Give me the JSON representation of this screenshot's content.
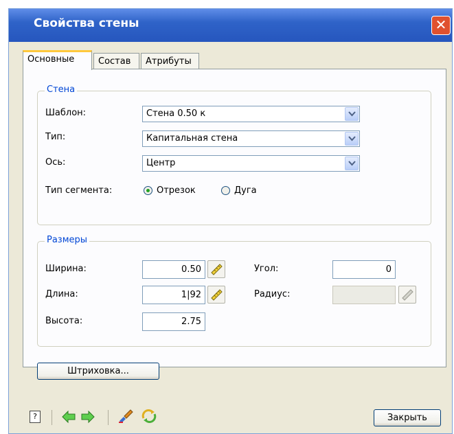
{
  "window": {
    "title": "Свойства стены",
    "close": "✕"
  },
  "tabs": [
    {
      "label": "Основные"
    },
    {
      "label": "Состав"
    },
    {
      "label": "Атрибуты"
    }
  ],
  "wall_group": {
    "legend": "Стена",
    "template_label": "Шаблон:",
    "template_value": "Стена 0.50 к",
    "type_label": "Тип:",
    "type_value": "Капитальная стена",
    "axis_label": "Ось:",
    "axis_value": "Центр",
    "segment_label": "Тип сегмента:",
    "segment_option1": "Отрезок",
    "segment_option2": "Дуга",
    "segment_selected": "Отрезок"
  },
  "size_group": {
    "legend": "Размеры",
    "width_label": "Ширина:",
    "width_value": "0.50",
    "length_label": "Длина:",
    "length_value": "1|92",
    "height_label": "Высота:",
    "height_value": "2.75",
    "angle_label": "Угол:",
    "angle_value": "0",
    "radius_label": "Радиус:",
    "radius_value": ""
  },
  "hatch_button": "Штриховка...",
  "close_button": "Закрыть",
  "toolbar": {
    "icons": [
      "help-icon",
      "back-arrow-icon",
      "forward-arrow-icon",
      "brush-icon",
      "refresh-icon"
    ]
  },
  "colors": {
    "title_bar": "#2f63c8",
    "legend": "#0046d5",
    "close": "#e0512f"
  }
}
